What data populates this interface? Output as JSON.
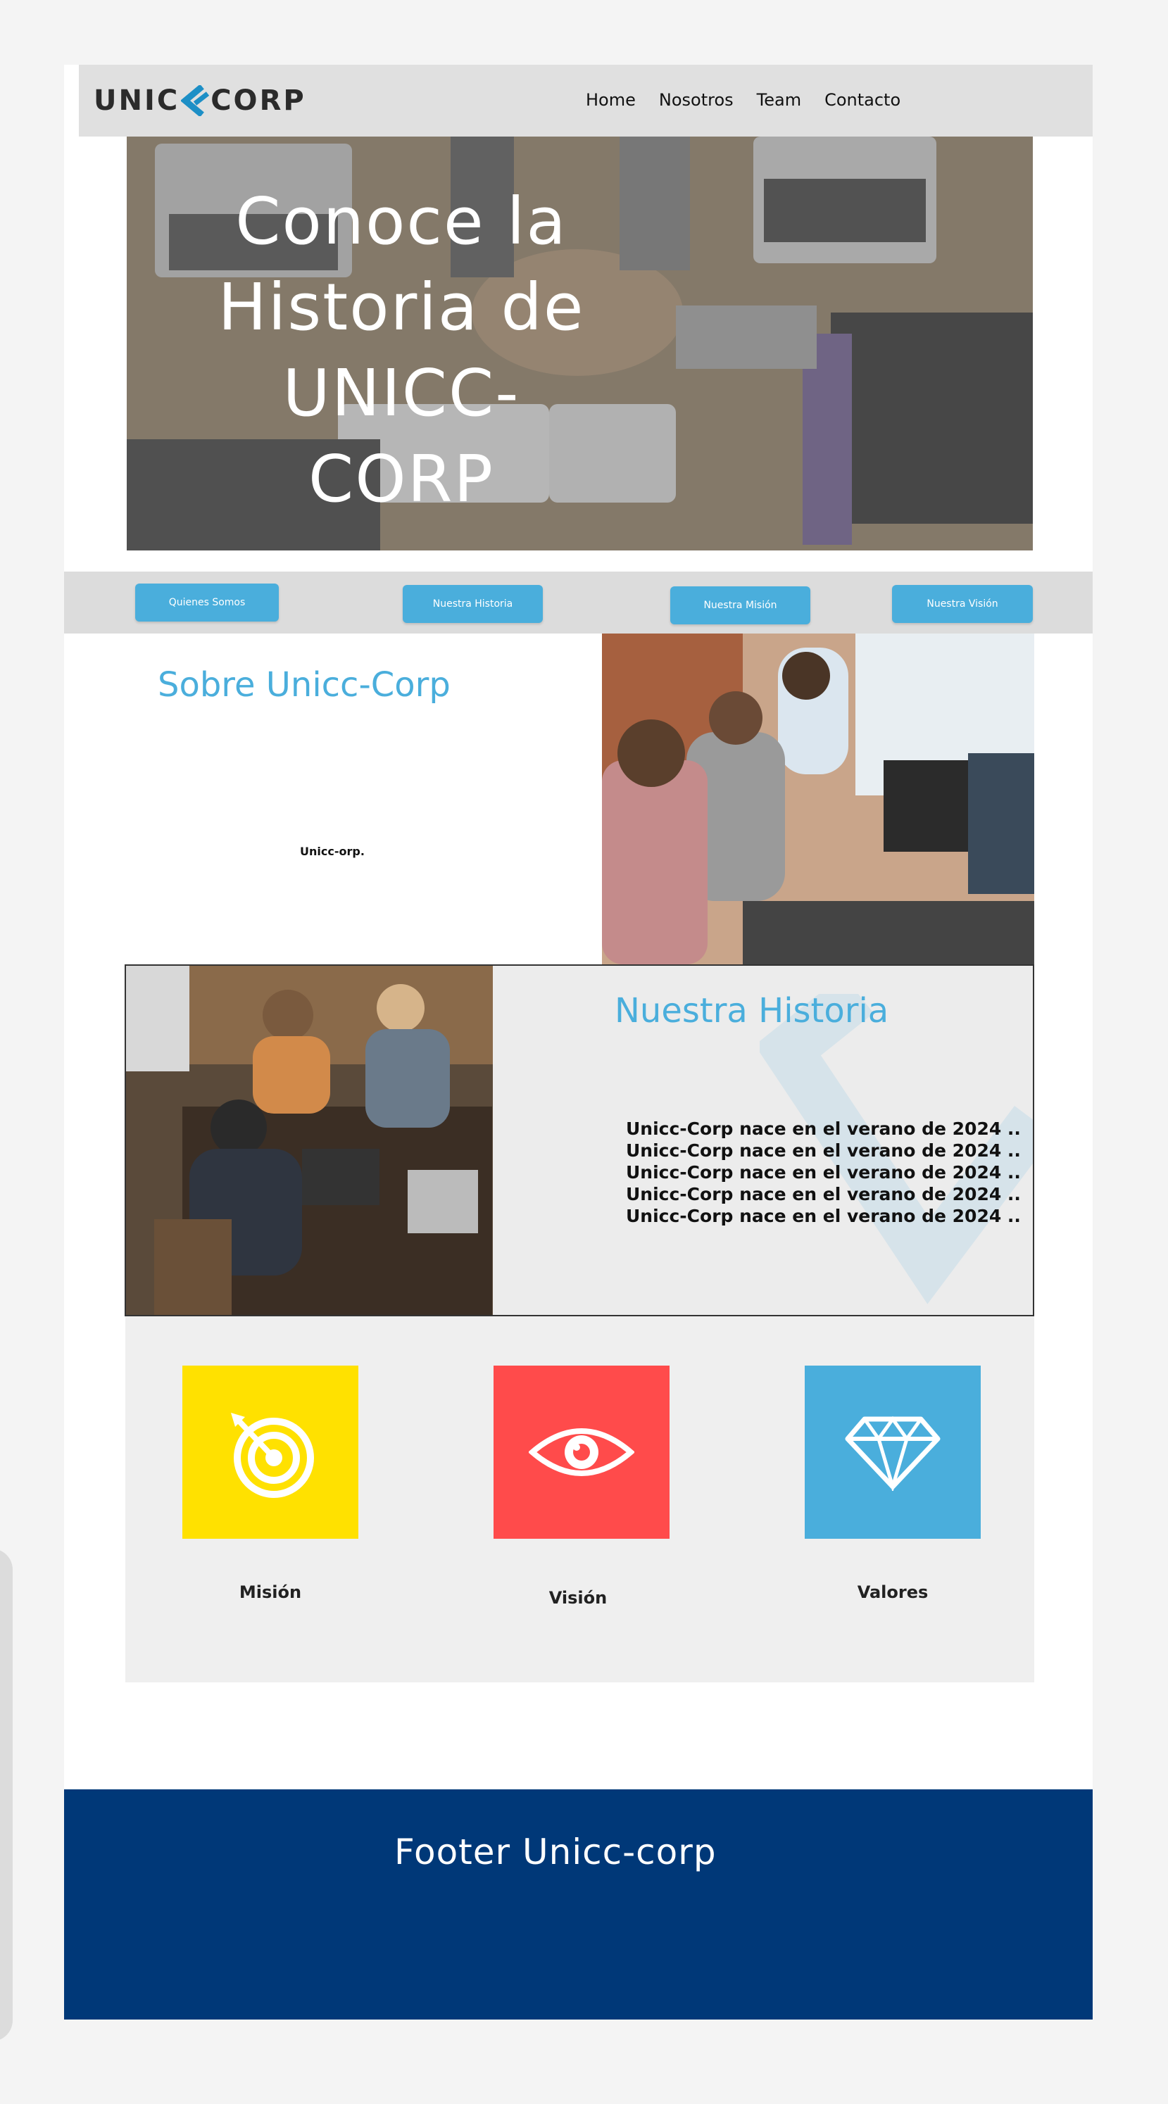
{
  "header": {
    "logo_left": "UNIC",
    "logo_right": "CORP",
    "nav": [
      "Home",
      "Nosotros",
      "Team",
      "Contacto"
    ]
  },
  "hero": {
    "title_lines": [
      "Conoce la",
      "Historia de",
      "UNICC-CORP"
    ]
  },
  "tabs": [
    "Quienes Somos",
    "Nuestra Historia",
    "Nuestra Misión",
    "Nuestra Visión"
  ],
  "sobre": {
    "title": "Sobre Unicc-Corp",
    "text": "Unicc-orp."
  },
  "historia": {
    "title": "Nuestra Historia",
    "lines": [
      "Unicc-Corp nace en el verano de 2024 ..",
      "Unicc-Corp nace en el verano de 2024 ..",
      "Unicc-Corp nace en el verano de 2024 ..",
      "Unicc-Corp nace en el verano de 2024 ..",
      "Unicc-Corp nace en el verano de 2024 .."
    ]
  },
  "cards": [
    {
      "label": "Misión",
      "icon": "target-icon",
      "color": "#ffe100"
    },
    {
      "label": "Visión",
      "icon": "eye-icon",
      "color": "#ff4b4b"
    },
    {
      "label": "Valores",
      "icon": "diamond-icon",
      "color": "#4aaedc"
    }
  ],
  "footer": {
    "title": "Footer Unicc-corp"
  },
  "colors": {
    "accent": "#4aaedc",
    "footer": "#003878",
    "header_bg": "#e0e0e0"
  }
}
